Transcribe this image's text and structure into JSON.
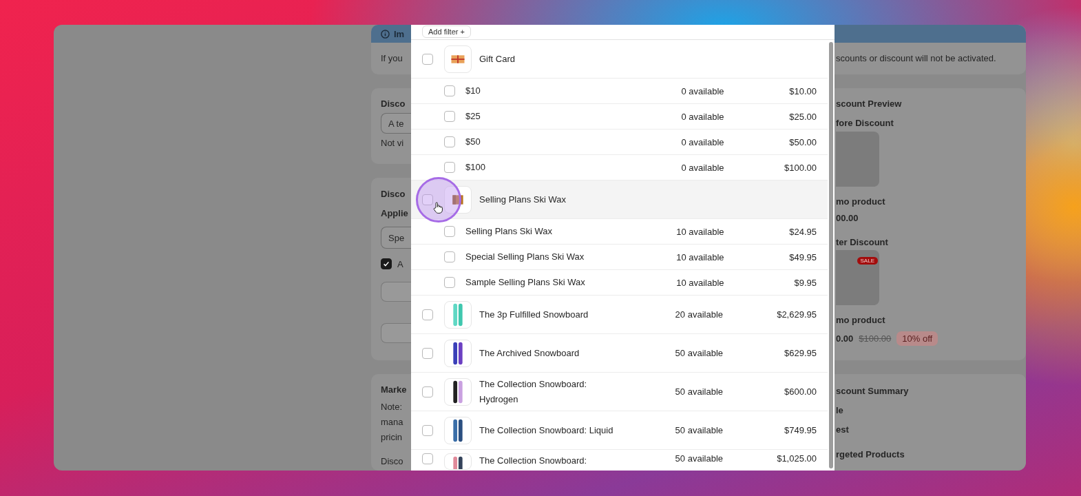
{
  "page_behind": {
    "left": {
      "notice_title": "Im",
      "notice_text": "If you",
      "title_card": {
        "heading": "Disco",
        "field_value": "A te",
        "help": "Not vi"
      },
      "products_card": {
        "heading": "Disco",
        "label": "Applie",
        "select_value": "Spe",
        "checkbox": {
          "label": "A",
          "checked": true
        }
      },
      "markets_card": {
        "heading": "Marke",
        "note_lines": [
          "Note:",
          "mana",
          "pricin"
        ],
        "subheading": "Disco"
      }
    },
    "right": {
      "notice_text": "scounts or discount will not be activated.",
      "preview": {
        "heading": "scount Preview",
        "before": {
          "label": "fore Discount",
          "product": "mo product",
          "price": "00.00"
        },
        "after": {
          "label": "ter Discount",
          "badge": "SALE",
          "product": "mo product",
          "price": "0.00",
          "compare_price": "$100.00",
          "discount_badge": "10% off"
        }
      },
      "summary": {
        "heading": "scount Summary",
        "lines": [
          "le",
          "est"
        ],
        "subheading": "rgeted Products"
      }
    }
  },
  "modal": {
    "filter_button": "Add filter +",
    "products": [
      {
        "name": "Gift Card",
        "kind": "gift-card",
        "checked": false,
        "hovered": false,
        "variants": [
          {
            "name": "$10",
            "available": "0 available",
            "price": "$10.00",
            "checked": false
          },
          {
            "name": "$25",
            "available": "0 available",
            "price": "$25.00",
            "checked": false
          },
          {
            "name": "$50",
            "available": "0 available",
            "price": "$50.00",
            "checked": false
          },
          {
            "name": "$100",
            "available": "0 available",
            "price": "$100.00",
            "checked": false
          }
        ]
      },
      {
        "name": "Selling Plans Ski Wax",
        "kind": "ski-wax",
        "checked": false,
        "hovered": true,
        "variants": [
          {
            "name": "Selling Plans Ski Wax",
            "available": "10 available",
            "price": "$24.95",
            "checked": false
          },
          {
            "name": "Special Selling Plans Ski Wax",
            "available": "10 available",
            "price": "$49.95",
            "checked": false
          },
          {
            "name": "Sample Selling Plans Ski Wax",
            "available": "10 available",
            "price": "$9.95",
            "checked": false
          }
        ]
      },
      {
        "name": "The 3p Fulfilled Snowboard",
        "kind": "snowboard",
        "checked": false,
        "hovered": false,
        "available": "20 available",
        "price": "$2,629.95"
      },
      {
        "name": "The Archived Snowboard",
        "kind": "snowboard",
        "checked": false,
        "hovered": false,
        "available": "50 available",
        "price": "$629.95"
      },
      {
        "name": "The Collection Snowboard: Hydrogen",
        "kind": "snowboard",
        "checked": false,
        "hovered": false,
        "available": "50 available",
        "price": "$600.00"
      },
      {
        "name": "The Collection Snowboard: Liquid",
        "kind": "snowboard",
        "checked": false,
        "hovered": false,
        "available": "50 available",
        "price": "$749.95"
      },
      {
        "name": "The Collection Snowboard:",
        "kind": "snowboard",
        "checked": false,
        "hovered": false,
        "available": "50 available",
        "price": "$1,025.00"
      }
    ]
  }
}
